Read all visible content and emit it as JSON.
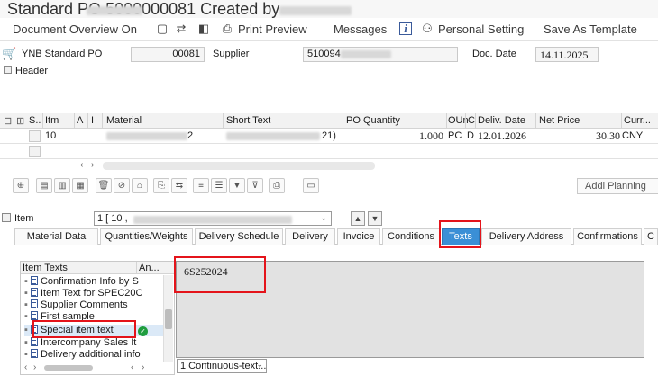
{
  "window": {
    "title": "Standard PO 5000000081 Created by"
  },
  "toolbar": {
    "document_overview": "Document Overview On",
    "print_preview": "Print Preview",
    "messages": "Messages",
    "personal_setting": "Personal Setting",
    "save_as_template": "Save As Template"
  },
  "header": {
    "doc_type": "YNB Standard PO",
    "po_number": "00081",
    "supplier_label": "Supplier",
    "supplier_value": "510094",
    "doc_date_label": "Doc. Date",
    "doc_date_value": "14.11.2025",
    "section_label": "Header"
  },
  "items_table": {
    "columns": [
      "S..",
      "Itm",
      "A",
      "I",
      "Material",
      "Short Text",
      "PO Quantity",
      "OUn",
      "C",
      "Deliv. Date",
      "Net Price",
      "Curr..."
    ],
    "rows": [
      {
        "item": "10",
        "material": "2",
        "short_text": "21)",
        "po_quantity": "1.000",
        "oun": "PC",
        "c": "D",
        "deliv_date": "12.01.2026",
        "net_price": "30.30",
        "currency": "CNY"
      }
    ]
  },
  "buttons": {
    "addl_planning": "Addl Planning"
  },
  "item_selector": {
    "label": "Item",
    "value": "1 [ 10 ,"
  },
  "tabs": [
    "Material Data",
    "Quantities/Weights",
    "Delivery Schedule",
    "Delivery",
    "Invoice",
    "Conditions",
    "Texts",
    "Delivery Address",
    "Confirmations",
    "C"
  ],
  "active_tab": "Texts",
  "texts_panel": {
    "tree_header": "Item Texts",
    "tree_header_col2": "An...",
    "items": [
      "Confirmation Info by S",
      "Item Text for SPEC20C",
      "Supplier Comments",
      "First sample",
      "Special item text",
      "Intercompany Sales It",
      "Delivery additional info"
    ],
    "selected_item": "Special item text",
    "editor_text": "6S252024",
    "format_select": "1 Continuous-text..."
  },
  "colors": {
    "active_tab": "#3a8fd6",
    "highlight_box": "#e4141b",
    "check": "#1f9d3f"
  }
}
